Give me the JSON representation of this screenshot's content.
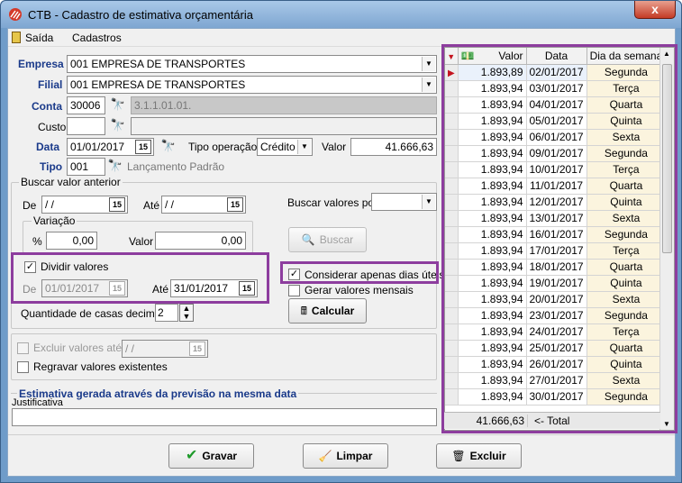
{
  "window": {
    "title": "CTB - Cadastro de estimativa orçamentária",
    "close_glyph": "x"
  },
  "menu": {
    "items": [
      "Saída",
      "Cadastros"
    ]
  },
  "form": {
    "empresa_label": "Empresa",
    "empresa_value": "001 EMPRESA DE TRANSPORTES",
    "filial_label": "Filial",
    "filial_value": "001 EMPRESA DE TRANSPORTES",
    "conta_label": "Conta",
    "conta_code": "30006",
    "conta_desc": "3.1.1.01.01.",
    "custo_label": "Custo",
    "data_label": "Data",
    "data_value": "01/01/2017",
    "tipo_operacao_label": "Tipo operação",
    "tipo_operacao_value": "Crédito",
    "valor_label": "Valor",
    "valor_value": "41.666,63",
    "tipo_label": "Tipo",
    "tipo_code": "001",
    "tipo_desc": "Lançamento Padrão",
    "cal_glyph": "15",
    "bino_glyph": "🔭"
  },
  "buscar": {
    "group_title": "Buscar valor anterior",
    "de_label": "De",
    "de_value": " / /",
    "ate_label": "Até",
    "ate_value": " / /",
    "buscar_por_label": "Buscar valores por",
    "variacao_title": "Variação",
    "pct_label": "%",
    "pct_value": "0,00",
    "valor_label": "Valor",
    "valor_value": "0,00",
    "buscar_button": "Buscar"
  },
  "dividir": {
    "checkbox_label": "Dividir valores",
    "de_label": "De",
    "de_value": "01/01/2017",
    "ate_label": "Até",
    "ate_value": "31/01/2017",
    "dias_uteis_label": "Considerar apenas dias úteis",
    "mensais_label": "Gerar valores mensais",
    "casas_label": "Quantidade de casas decimais",
    "casas_value": "2",
    "calcular_button": "Calcular",
    "check_glyph": "✓"
  },
  "options": {
    "excluir_label": "Excluir valores até",
    "excluir_value": " / /",
    "regravar_label": "Regravar valores existentes"
  },
  "estimativa_label": "Estimativa gerada através da previsão na mesma data",
  "justificativa_label": "Justificativa",
  "grid": {
    "headers": [
      "Valor",
      "Data",
      "Dia da semana"
    ],
    "rows": [
      {
        "valor": "1.893,89",
        "data": "02/01/2017",
        "dia": "Segunda"
      },
      {
        "valor": "1.893,94",
        "data": "03/01/2017",
        "dia": "Terça"
      },
      {
        "valor": "1.893,94",
        "data": "04/01/2017",
        "dia": "Quarta"
      },
      {
        "valor": "1.893,94",
        "data": "05/01/2017",
        "dia": "Quinta"
      },
      {
        "valor": "1.893,94",
        "data": "06/01/2017",
        "dia": "Sexta"
      },
      {
        "valor": "1.893,94",
        "data": "09/01/2017",
        "dia": "Segunda"
      },
      {
        "valor": "1.893,94",
        "data": "10/01/2017",
        "dia": "Terça"
      },
      {
        "valor": "1.893,94",
        "data": "11/01/2017",
        "dia": "Quarta"
      },
      {
        "valor": "1.893,94",
        "data": "12/01/2017",
        "dia": "Quinta"
      },
      {
        "valor": "1.893,94",
        "data": "13/01/2017",
        "dia": "Sexta"
      },
      {
        "valor": "1.893,94",
        "data": "16/01/2017",
        "dia": "Segunda"
      },
      {
        "valor": "1.893,94",
        "data": "17/01/2017",
        "dia": "Terça"
      },
      {
        "valor": "1.893,94",
        "data": "18/01/2017",
        "dia": "Quarta"
      },
      {
        "valor": "1.893,94",
        "data": "19/01/2017",
        "dia": "Quinta"
      },
      {
        "valor": "1.893,94",
        "data": "20/01/2017",
        "dia": "Sexta"
      },
      {
        "valor": "1.893,94",
        "data": "23/01/2017",
        "dia": "Segunda"
      },
      {
        "valor": "1.893,94",
        "data": "24/01/2017",
        "dia": "Terça"
      },
      {
        "valor": "1.893,94",
        "data": "25/01/2017",
        "dia": "Quarta"
      },
      {
        "valor": "1.893,94",
        "data": "26/01/2017",
        "dia": "Quinta"
      },
      {
        "valor": "1.893,94",
        "data": "27/01/2017",
        "dia": "Sexta"
      },
      {
        "valor": "1.893,94",
        "data": "30/01/2017",
        "dia": "Segunda"
      }
    ],
    "total_value": "41.666,63",
    "total_label": "<- Total",
    "selected_row": 0
  },
  "buttons": {
    "gravar": "Gravar",
    "limpar": "Limpar",
    "excluir": "Excluir"
  },
  "colors": {
    "accent_label": "#1a3a8a",
    "highlight": "#8d3d9e",
    "weekday_cell": "#fbf4de"
  }
}
